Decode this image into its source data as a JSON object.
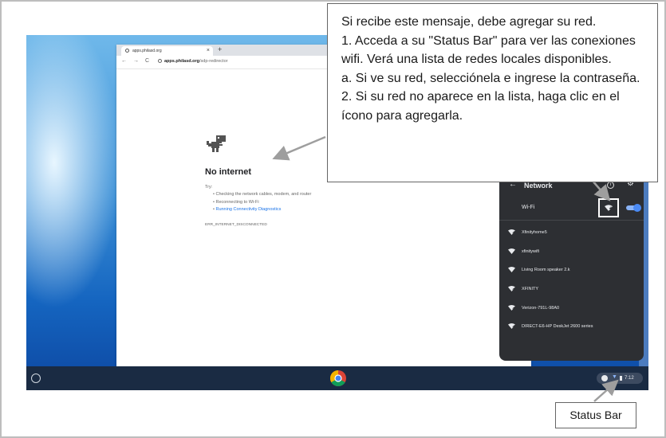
{
  "browser": {
    "tab_title": "apps.philasd.org",
    "tab_close": "×",
    "new_tab": "+",
    "url_domain": "apps.philasd.org",
    "url_path": "/sdp-redirector"
  },
  "error_page": {
    "title": "No internet",
    "try_label": "Try:",
    "suggestions": [
      "Checking the network cables, modem, and router",
      "Reconnecting to Wi-Fi",
      "Running Connectivity Diagnostics"
    ],
    "error_code": "ERR_INTERNET_DISCONNECTED"
  },
  "network_panel": {
    "title": "Network",
    "wifi_label": "Wi-Fi",
    "wifi_enabled": true,
    "networks": [
      {
        "name": "Xfinityhome5",
        "icon": "wifi-icon"
      },
      {
        "name": "xfinitywifi",
        "icon": "wifi-icon"
      },
      {
        "name": "Living Room speaker 2.k",
        "icon": "wifi-icon"
      },
      {
        "name": "XFINITY",
        "icon": "wifi-icon"
      },
      {
        "name": "Verizon-791L-98A0",
        "icon": "wifi-icon"
      },
      {
        "name": "DIRECT-E6-HP DeskJet 2600 series",
        "icon": "wifi-icon"
      }
    ]
  },
  "shelf": {
    "time": "7:12"
  },
  "callouts": {
    "main_lines": [
      "Si recibe este mensaje, debe agregar su red.",
      "1. Acceda a su \"Status Bar\" para ver las conexiones wifi. Verá una lista de redes locales disponibles.",
      "a. Si ve su red, selecciónela e ingrese la contraseña.",
      "2. Si su red no aparece en la lista, haga clic en el ícono para agregarla."
    ],
    "status_bar_label": "Status Bar"
  },
  "colors": {
    "accent": "#1a73e8",
    "panel_bg": "#2d2f33",
    "shelf_bg": "#1a2b43"
  }
}
